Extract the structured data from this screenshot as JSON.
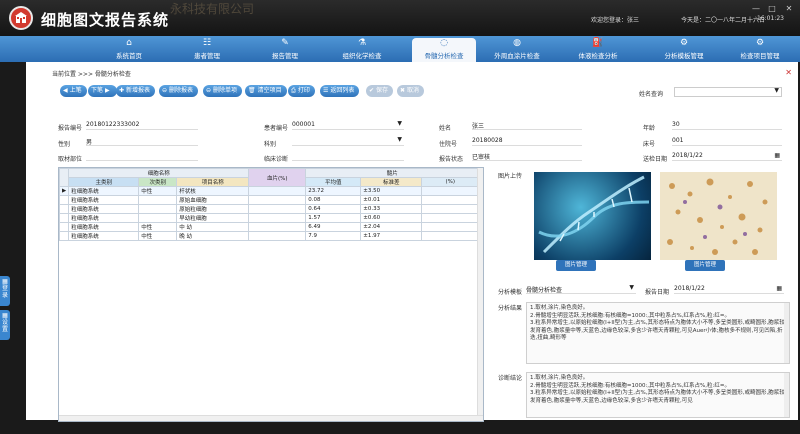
{
  "app": {
    "title": "细胞图文报告系统",
    "watermark": "永科技有限公司",
    "welcome": "欢迎您登录：张三",
    "date": "今天是：二〇一八年二月十六日",
    "time": "16:01:23"
  },
  "nav": [
    {
      "label": "系统首页",
      "icon": "⌂"
    },
    {
      "label": "患者管理",
      "icon": "☷"
    },
    {
      "label": "报告管理",
      "icon": "✎"
    },
    {
      "label": "组织化学检查",
      "icon": "⚗"
    },
    {
      "label": "骨髓分析检查",
      "icon": "◌"
    },
    {
      "label": "外周血涂片检查",
      "icon": "◍"
    },
    {
      "label": "体液检查分析",
      "icon": "⛽"
    },
    {
      "label": "分析模板管理",
      "icon": "⚙"
    },
    {
      "label": "检查项目管理",
      "icon": "⚙"
    }
  ],
  "side": {
    "login": "登录",
    "settings": "设置"
  },
  "breadcrumb": "当前位置 >>> 骨髓分析检查",
  "toolbar": {
    "prev": "上笔",
    "next": "下笔",
    "add": "新增报表",
    "del_report": "删除报表",
    "del_item": "删除单项",
    "clear": "清空项目",
    "print": "打印",
    "back": "返回列表",
    "save": "保存",
    "cancel": "取消"
  },
  "name_query": {
    "label": "姓名查询",
    "value": ""
  },
  "form": {
    "report_no_label": "报告编号",
    "report_no": "20180122333002",
    "patient_no_label": "患者编号",
    "patient_no": "000001",
    "name_label": "姓名",
    "name": "张三",
    "age_label": "年龄",
    "age": "30",
    "sex_label": "性别",
    "sex": "男",
    "dept_label": "科别",
    "dept": "",
    "inpatient_label": "住院号",
    "inpatient": "20180028",
    "bed_label": "床号",
    "bed": "001",
    "site_label": "取材部位",
    "site": "",
    "diag_label": "临床诊断",
    "diag": "",
    "status_label": "报告状态",
    "status": "已审核",
    "send_label": "送检日期",
    "send": "2018/1/22"
  },
  "grid": {
    "h_cell": "细胞名称",
    "h_main": "主类别",
    "h_sub": "次类别",
    "h_item": "项目名称",
    "h_blood": "血片(%)",
    "h_bm": "髓片",
    "h_mean": "平均值",
    "h_std": "标准差",
    "h_pct": "(%)",
    "rows": [
      {
        "main": "粒细胞系统",
        "sub": "中性",
        "item": "杆状核",
        "blood": "",
        "mean": "23.72",
        "std": "±3.50",
        "pct": ""
      },
      {
        "main": "粒细胞系统",
        "sub": "",
        "item": "原始血细胞",
        "blood": "",
        "mean": "0.08",
        "std": "±0.01",
        "pct": ""
      },
      {
        "main": "粒细胞系统",
        "sub": "",
        "item": "原始粒细胞",
        "blood": "",
        "mean": "0.64",
        "std": "±0.33",
        "pct": ""
      },
      {
        "main": "粒细胞系统",
        "sub": "",
        "item": "早幼粒细胞",
        "blood": "",
        "mean": "1.57",
        "std": "±0.60",
        "pct": ""
      },
      {
        "main": "粒细胞系统",
        "sub": "中性",
        "item": "中 幼",
        "blood": "",
        "mean": "6.49",
        "std": "±2.04",
        "pct": ""
      },
      {
        "main": "粒细胞系统",
        "sub": "中性",
        "item": "晚 幼",
        "blood": "",
        "mean": "7.9",
        "std": "±1.97",
        "pct": ""
      }
    ]
  },
  "images": {
    "upload_label": "图片上传",
    "btn1": "图片管理",
    "btn2": "图片管理"
  },
  "analysis": {
    "template_label": "分析模板",
    "template": "骨髓分析检查",
    "date_label": "报告日期",
    "date": "2018/1/22",
    "result_label": "分析结果",
    "result": [
      "1.取材,涂片,染色良好。",
      "2.骨髓增生明显活跃,无核细胞:有核细胞=1000:,其中粒系占%,红系占%,粒:红=。",
      "3.粒系异常增生,以原始粒细胞(I+II型)为主,占%,其形态特点为胞体大小不等,多呈类圆形,或畸圆形,胞浆较发育着色,胞浆量中等,天蓝色,边缘色较深,多含少许嗜天青颗粒,可见Auer小体;胞核多不规则,可见凹陷,折迭,扭曲,畸形等"
    ],
    "conclusion_label": "诊断结论",
    "conclusion": [
      "1.取材,涂片,染色良好。",
      "2.骨髓增生明显活跃,无核细胞:有核细胞=1000:,其中粒系占%,红系占%,粒:红=。",
      "3.粒系异常增生,以原始粒细胞(I+II型)为主,占%,其形态特点为胞体大小不等,多呈类圆形,或畸圆形,胞浆较发育着色,胞浆量中等,天蓝色,边缘色较深,多含少许嗜天青颗粒,可见"
    ]
  }
}
